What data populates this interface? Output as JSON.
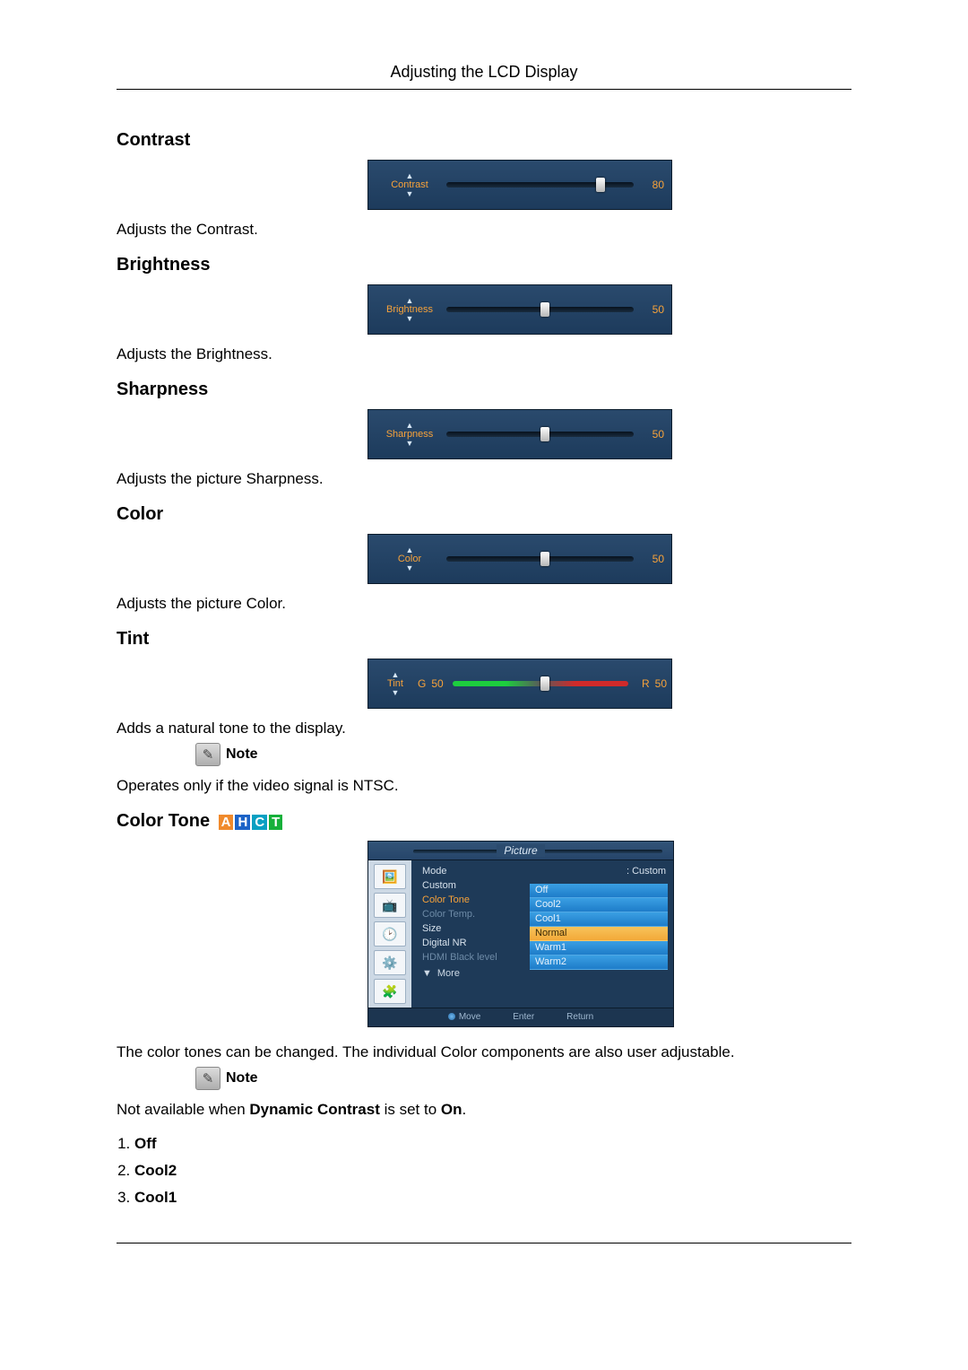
{
  "header": {
    "title": "Adjusting the LCD Display"
  },
  "sections": {
    "contrast": {
      "heading": "Contrast",
      "slider": {
        "label": "Contrast",
        "value": "80",
        "percent": 80
      },
      "description": "Adjusts the Contrast."
    },
    "brightness": {
      "heading": "Brightness",
      "slider": {
        "label": "Brightness",
        "value": "50",
        "percent": 50
      },
      "description": "Adjusts the Brightness."
    },
    "sharpness": {
      "heading": "Sharpness",
      "slider": {
        "label": "Sharpness",
        "value": "50",
        "percent": 50
      },
      "description": "Adjusts the picture Sharpness."
    },
    "color": {
      "heading": "Color",
      "slider": {
        "label": "Color",
        "value": "50",
        "percent": 50
      },
      "description": "Adjusts the picture Color."
    },
    "tint": {
      "heading": "Tint",
      "slider": {
        "label": "Tint",
        "left_letter": "G",
        "left_value": "50",
        "right_letter": "R",
        "right_value": "50",
        "percent": 50
      },
      "description": "Adds a natural tone to the display.",
      "note_label": "Note",
      "note_text": "Operates only if the video signal is NTSC."
    },
    "color_tone": {
      "heading": "Color Tone",
      "tags": {
        "a": "A",
        "h": "H",
        "c": "C",
        "t": "T"
      },
      "menu": {
        "title": "Picture",
        "rows": [
          {
            "key": "Mode",
            "value": ": Custom",
            "dim": false,
            "active": false
          },
          {
            "key": "Custom",
            "value": "",
            "dim": false,
            "active": false
          },
          {
            "key": "Color Tone",
            "value": ":",
            "dim": false,
            "active": true
          },
          {
            "key": "Color Temp.",
            "value": ":",
            "dim": true,
            "active": false
          },
          {
            "key": "Size",
            "value": ":",
            "dim": false,
            "active": false
          },
          {
            "key": "Digital NR",
            "value": "",
            "dim": false,
            "active": false
          },
          {
            "key": "HDMI Black level",
            "value": "",
            "dim": true,
            "active": false
          }
        ],
        "more_label": "More",
        "dropdown": [
          "Off",
          "Cool2",
          "Cool1",
          "Normal",
          "Warm1",
          "Warm2"
        ],
        "dropdown_selected": 3,
        "footer": {
          "move": "Move",
          "enter": "Enter",
          "ret": "Return"
        }
      },
      "description": "The color tones can be changed. The individual Color components are also user adjustable.",
      "note_label": "Note",
      "note_text_before": "Not available when ",
      "note_text_bold1": "Dynamic Contrast",
      "note_text_mid": " is set to ",
      "note_text_bold2": "On",
      "note_text_after": ".",
      "options": [
        "Off",
        "Cool2",
        "Cool1"
      ]
    }
  }
}
